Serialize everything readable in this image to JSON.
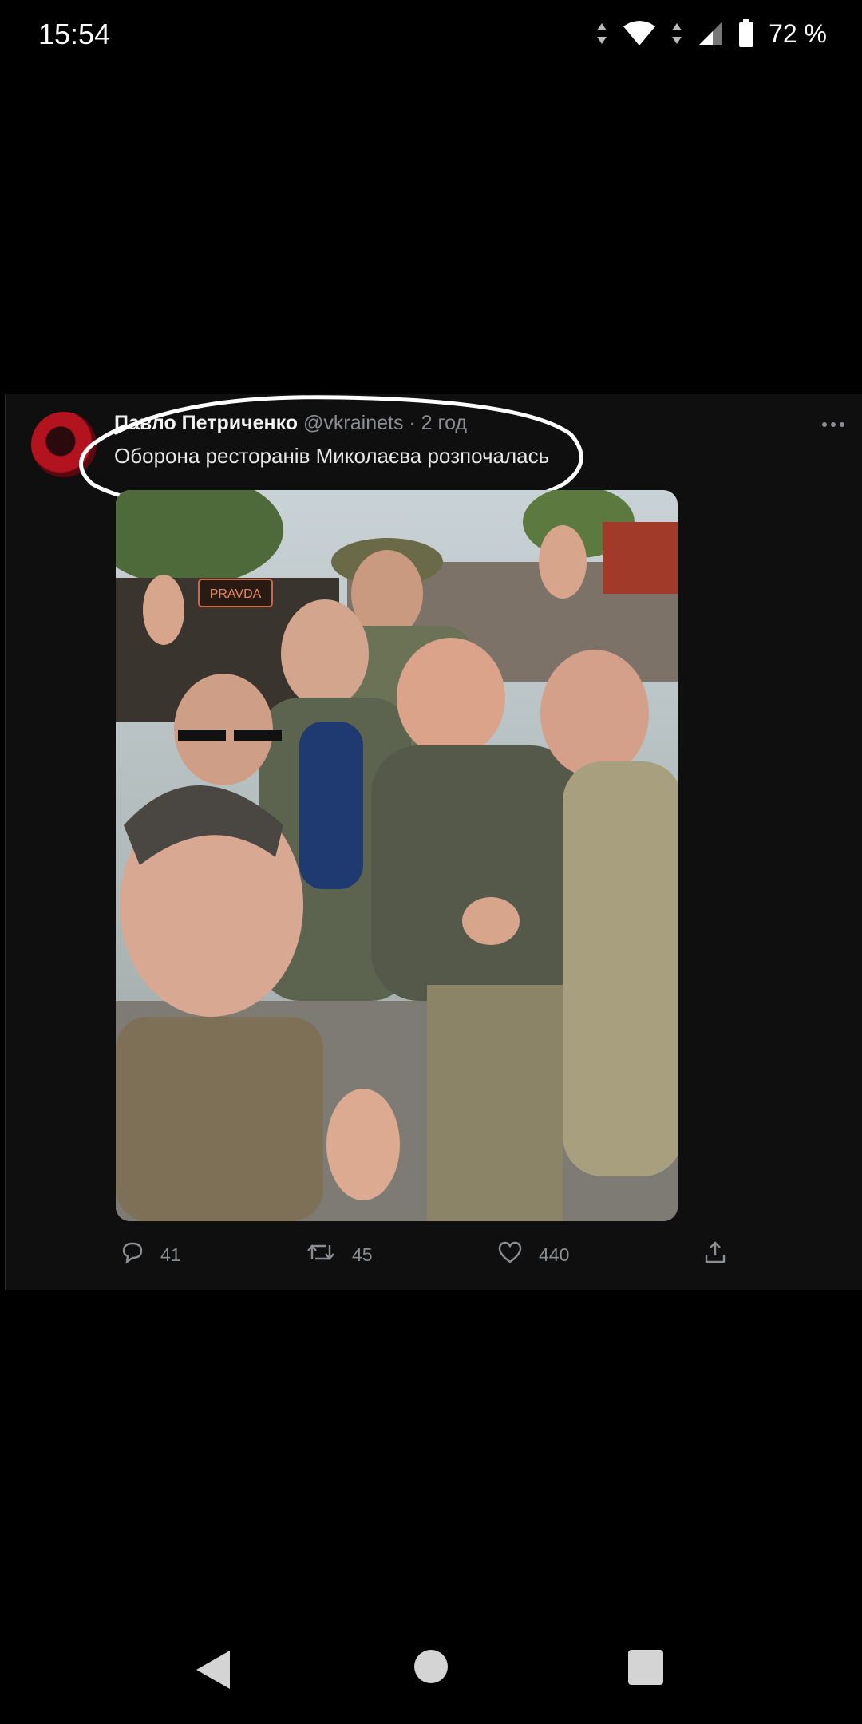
{
  "status_bar": {
    "time": "15:54",
    "battery": "72 %",
    "icons": [
      "data-arrows-icon",
      "wifi-icon",
      "signal-icon",
      "battery-icon"
    ]
  },
  "tweet": {
    "author_name": "Павло Петриченко",
    "meta": "@vkrainets · 2 год",
    "text": "Оборона ресторанів Миколаєва розпочалась",
    "photo_sign": "PRAVDA",
    "replies": "41",
    "retweets": "45",
    "likes": "440"
  },
  "colors": {
    "background": "#000000",
    "card": "#0f0f10",
    "muted": "#8b8f93",
    "annotation": "#ffffff"
  },
  "nav_bar": {
    "icons": [
      "back-icon",
      "home-icon",
      "recents-icon"
    ]
  }
}
